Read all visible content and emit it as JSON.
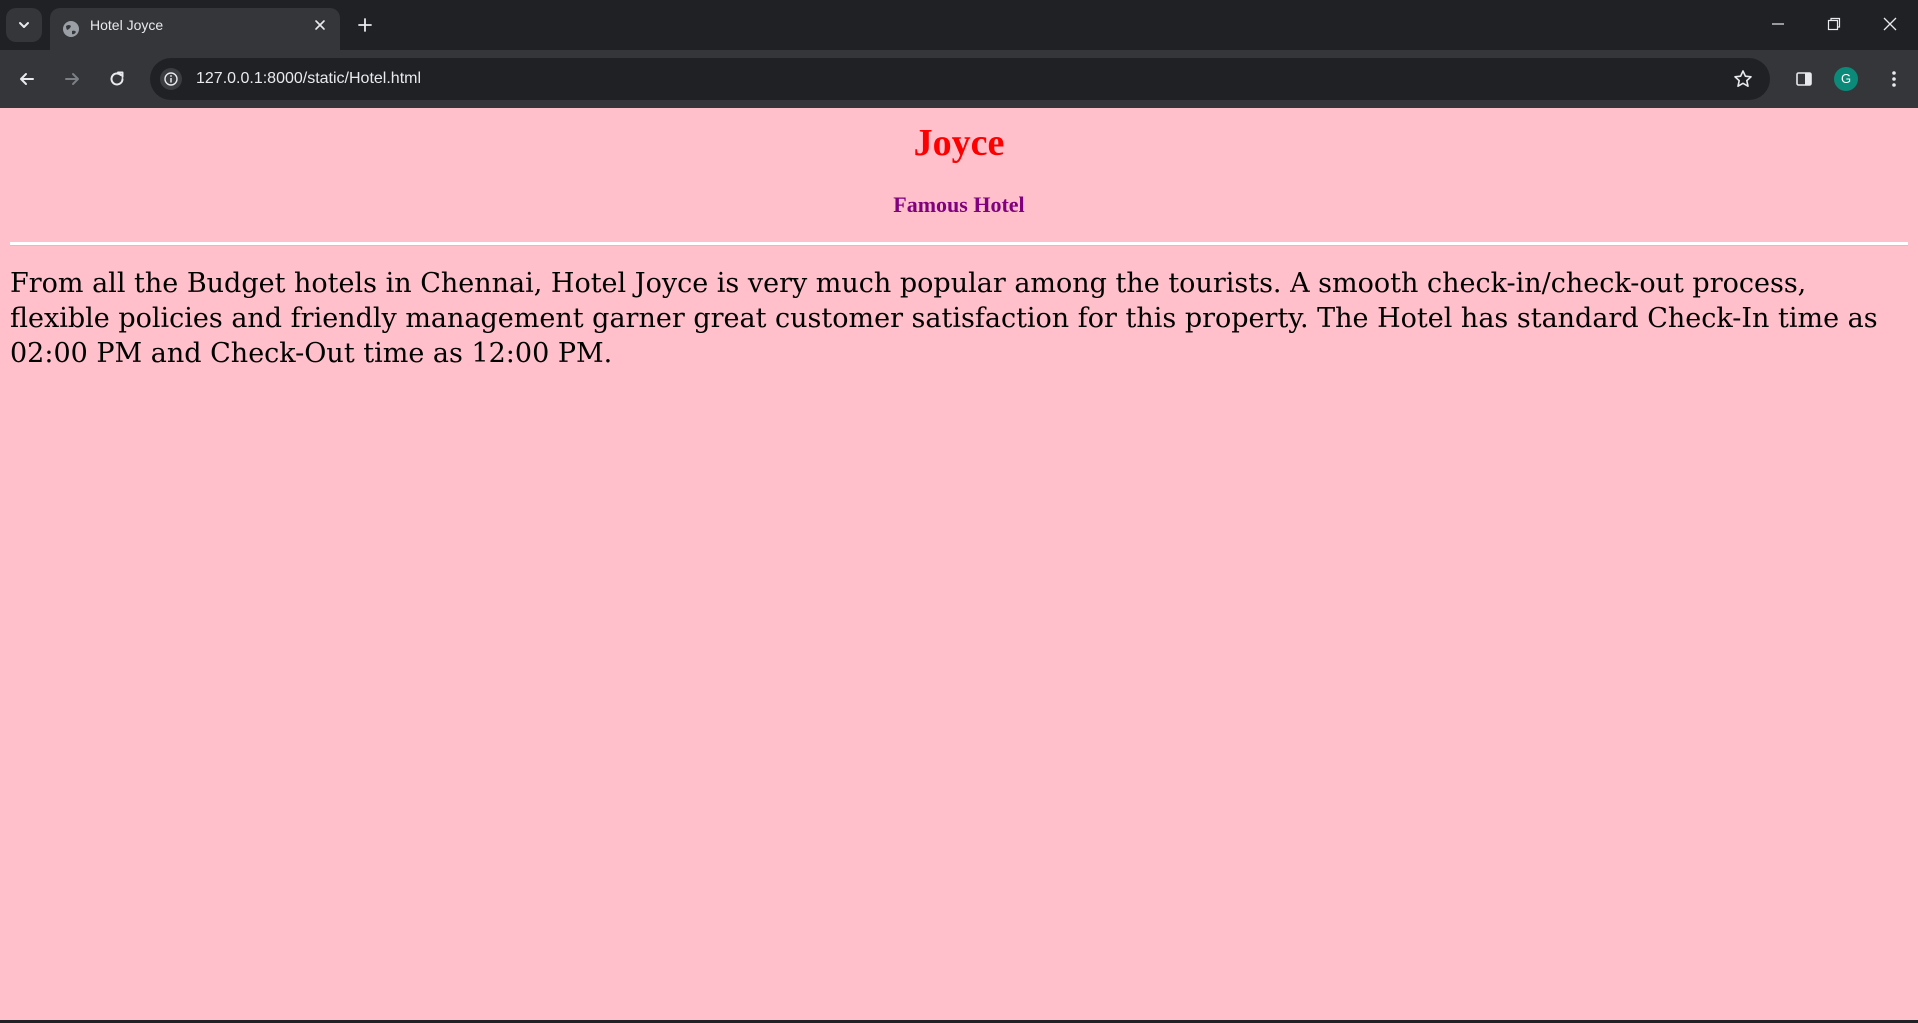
{
  "browser": {
    "tab_title": "Hotel Joyce",
    "url": "127.0.0.1:8000/static/Hotel.html",
    "profile_initial": "G",
    "icons": {
      "tab_search": "chevron-down-icon",
      "favicon": "globe-icon",
      "tab_close": "close-icon",
      "new_tab": "plus-icon",
      "minimize": "minimize-icon",
      "restore": "restore-icon",
      "close_window": "close-icon",
      "back": "back-arrow-icon",
      "forward": "forward-arrow-icon",
      "reload": "reload-icon",
      "site_info": "info-icon",
      "bookmark": "star-icon",
      "side_panel": "side-panel-icon",
      "menu": "kebab-menu-icon"
    }
  },
  "page": {
    "heading": "Joyce",
    "subheading": "Famous Hotel",
    "paragraph": "From all the Budget hotels in Chennai, Hotel Joyce is very much popular among the tourists. A smooth check-in/check-out process, flexible policies and friendly management garner great customer satisfaction for this property. The Hotel has standard Check-In time as 02:00 PM and Check-Out time as 12:00 PM."
  },
  "colors": {
    "page_background": "#ffc0cb",
    "heading": "#ff0000",
    "subheading": "#800080",
    "body_text": "#000000",
    "divider": "#ffffff",
    "browser_frame": "#202124",
    "toolbar": "#35363a",
    "avatar": "#0b8a7a"
  }
}
